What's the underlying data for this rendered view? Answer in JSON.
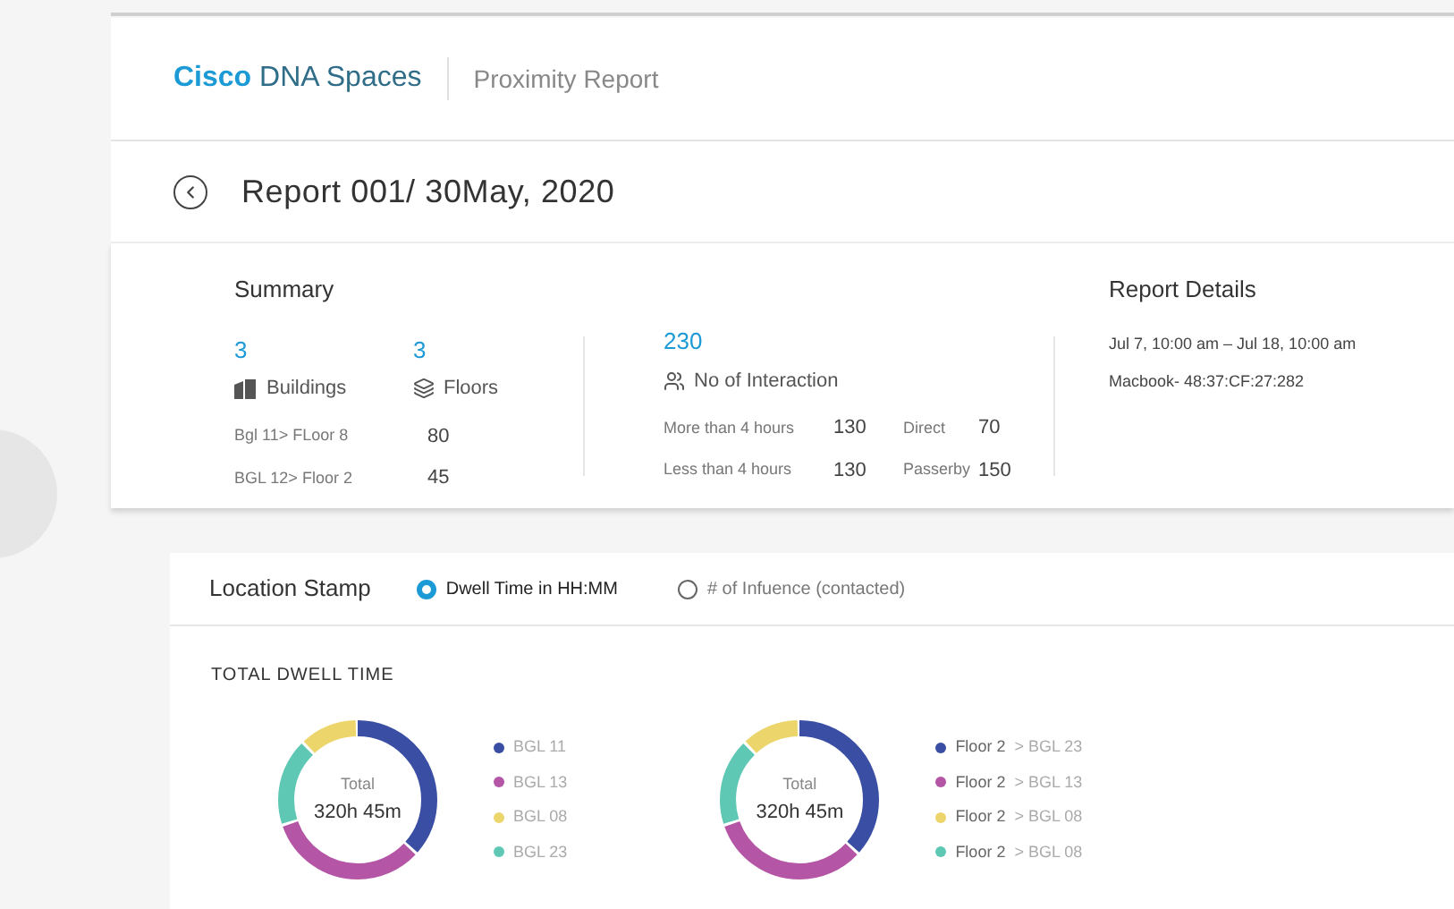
{
  "header": {
    "brand_bold": "Cisco",
    "brand_rest": "DNA Spaces",
    "page_title": "Proximity Report"
  },
  "report": {
    "title": "Report 001/ 30May, 2020"
  },
  "summary": {
    "title": "Summary",
    "buildings": {
      "count": "3",
      "label": "Buildings"
    },
    "floors": {
      "count": "3",
      "label": "Floors"
    },
    "floor_rows": [
      {
        "name": "Bgl 11> FLoor 8",
        "value": "80"
      },
      {
        "name": "BGL 12> Floor 2",
        "value": "45"
      }
    ],
    "interaction": {
      "count": "230",
      "label": "No of Interaction"
    },
    "interaction_rows": [
      {
        "name": "More than 4 hours",
        "value": "130",
        "name_2": "Direct",
        "value_2": "70"
      },
      {
        "name": "Less than 4 hours",
        "value": "130",
        "name_2": "Passerby",
        "value_2": "150"
      }
    ]
  },
  "report_details": {
    "title": "Report Details",
    "lines": [
      "Jul 7, 10:00 am – Jul 18, 10:00 am",
      "Macbook- 48:37:CF:27:282"
    ]
  },
  "location_stamp": {
    "title": "Location Stamp",
    "options": [
      {
        "label": "Dwell Time in HH:MM",
        "selected": true
      },
      {
        "label": "# of Infuence (contacted)",
        "selected": false
      }
    ],
    "section_title": "TOTAL DWELL TIME",
    "donuts": [
      {
        "center_label": "Total",
        "center_value": "320h 45m",
        "legend": [
          {
            "label": "BGL 11",
            "color": "#3a4fa3"
          },
          {
            "label": "BGL 13",
            "color": "#b455a5"
          },
          {
            "label": "BGL 08",
            "color": "#ecd56a"
          },
          {
            "label": "BGL 23",
            "color": "#5fc8b4"
          }
        ]
      },
      {
        "center_label": "Total",
        "center_value": "320h 45m",
        "legend": [
          {
            "label": "Floor 2",
            "sub": "> BGL 23",
            "color": "#3a4fa3"
          },
          {
            "label": "Floor 2",
            "sub": "> BGL 13",
            "color": "#b455a5"
          },
          {
            "label": "Floor 2",
            "sub": "> BGL 08",
            "color": "#ecd56a"
          },
          {
            "label": "Floor 2",
            "sub": "> BGL 08",
            "color": "#5fc8b4"
          }
        ]
      }
    ]
  }
}
